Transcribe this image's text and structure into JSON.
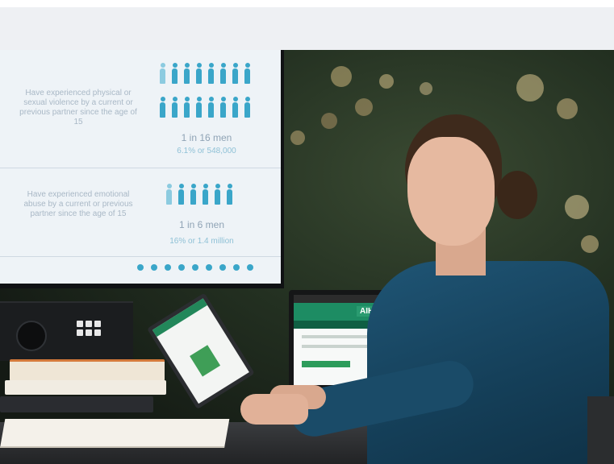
{
  "tv": {
    "stat1_text": "Have experienced physical or sexual violence by a current or previous partner since the age of 15",
    "stat1_big": "1 in 16 men",
    "stat1_small": "6.1% or 548,000",
    "stat2_text": "Have experienced emotional abuse by a current or previous partner since the age of 15",
    "stat2_big": "1 in 6 men",
    "stat2_small": "16% or 1.4 million"
  },
  "laptop": {
    "logo": "AIHW"
  },
  "colors": {
    "accent_blue": "#3aa6c9",
    "aihw_green": "#1d8c63",
    "jacket": "#1f5575"
  }
}
